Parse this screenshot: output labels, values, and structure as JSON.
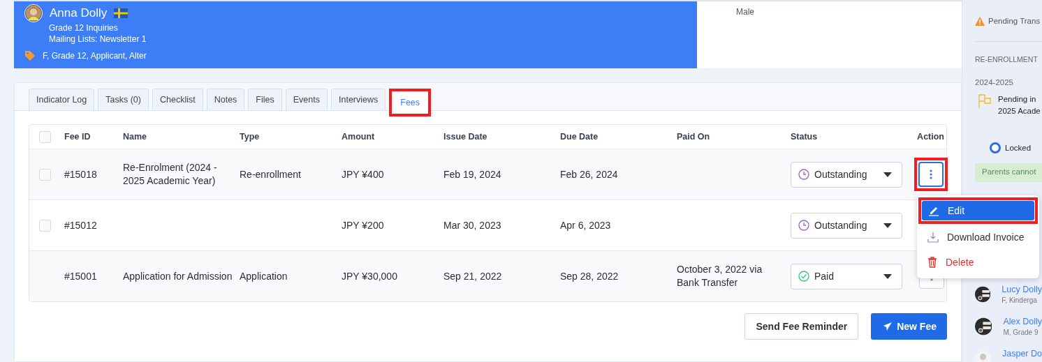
{
  "profile": {
    "name": "Anna Dolly",
    "lines": [
      "Grade 12 Inquiries",
      "Mailing Lists: Newsletter 1"
    ],
    "tags": "F, Grade 12, Applicant, Alter",
    "gender": "Male"
  },
  "tabs": [
    {
      "label": "Indicator Log",
      "selected": false,
      "highlighted": false
    },
    {
      "label": "Tasks (0)",
      "selected": false,
      "highlighted": false
    },
    {
      "label": "Checklist",
      "selected": false,
      "highlighted": false
    },
    {
      "label": "Notes",
      "selected": false,
      "highlighted": false
    },
    {
      "label": "Files",
      "selected": false,
      "highlighted": false
    },
    {
      "label": "Events",
      "selected": false,
      "highlighted": false
    },
    {
      "label": "Interviews",
      "selected": false,
      "highlighted": false
    },
    {
      "label": "Fees",
      "selected": true,
      "highlighted": true
    }
  ],
  "table": {
    "header_checked": false,
    "columns": [
      "Fee ID",
      "Name",
      "Type",
      "Amount",
      "Issue Date",
      "Due Date",
      "Paid On",
      "Status",
      "Action"
    ],
    "rows": [
      {
        "fee_id": "#15018",
        "name": "Re-Enrolment (2024 - 2025 Academic Year)",
        "type": "Re-enrollment",
        "amount": "JPY ¥400",
        "issue_date": "Feb 19, 2024",
        "due_date": "Feb 26, 2024",
        "status": {
          "kind": "outstanding",
          "label": "Outstanding"
        },
        "kind": "selectable",
        "checked": false,
        "shaded": true,
        "has_action_button": true,
        "menu_open": true,
        "highlighted": true
      },
      {
        "fee_id": "#15012",
        "amount": "JPY ¥200",
        "issue_date": "Mar 30, 2023",
        "due_date": "Apr 6, 2023",
        "status": {
          "kind": "outstanding",
          "label": "Outstanding"
        },
        "kind": "selectable",
        "checked": false,
        "shaded": false,
        "has_action_button": false,
        "menu_open": false,
        "highlighted": false
      },
      {
        "fee_id": "#15001",
        "name": "Application for Admission",
        "type": "Application",
        "amount": "JPY ¥30,000",
        "issue_date": "Sep 21, 2022",
        "due_date": "Sep 28, 2022",
        "paid_on": "October 3, 2022 via Bank Transfer",
        "status": {
          "kind": "paid",
          "label": "Paid"
        },
        "kind": "plain",
        "shaded": true,
        "has_action_button": true,
        "menu_open": false,
        "highlighted": false
      }
    ]
  },
  "buttons": [
    {
      "kind": "secondary",
      "label": "Send Fee Reminder"
    },
    {
      "kind": "primary",
      "label": "New Fee"
    }
  ],
  "action_menu": [
    {
      "kind": "edit",
      "label": "Edit",
      "selected": true,
      "highlighted": true
    },
    {
      "kind": "download",
      "label": "Download Invoice",
      "selected": false,
      "highlighted": false
    },
    {
      "kind": "delete",
      "label": "Delete",
      "selected": false,
      "highlighted": false
    }
  ],
  "sidebar": {
    "alert": "Pending Trans",
    "section": "RE-ENROLLMENT",
    "year": "2024-2025",
    "status": "Pending in",
    "status_line_2": "2025 Acade",
    "lock": {
      "label": "Locked",
      "selected": true
    },
    "notice": "Parents cannot",
    "contacts": [
      {
        "name": "Lucy Dolly",
        "detail": "F, Kinderga",
        "kind": "picture"
      },
      {
        "name": "Alex Dolly",
        "detail": "M, Grade 9",
        "kind": "picture"
      },
      {
        "name": "Jasper Do",
        "kind": "silhouette"
      }
    ]
  }
}
